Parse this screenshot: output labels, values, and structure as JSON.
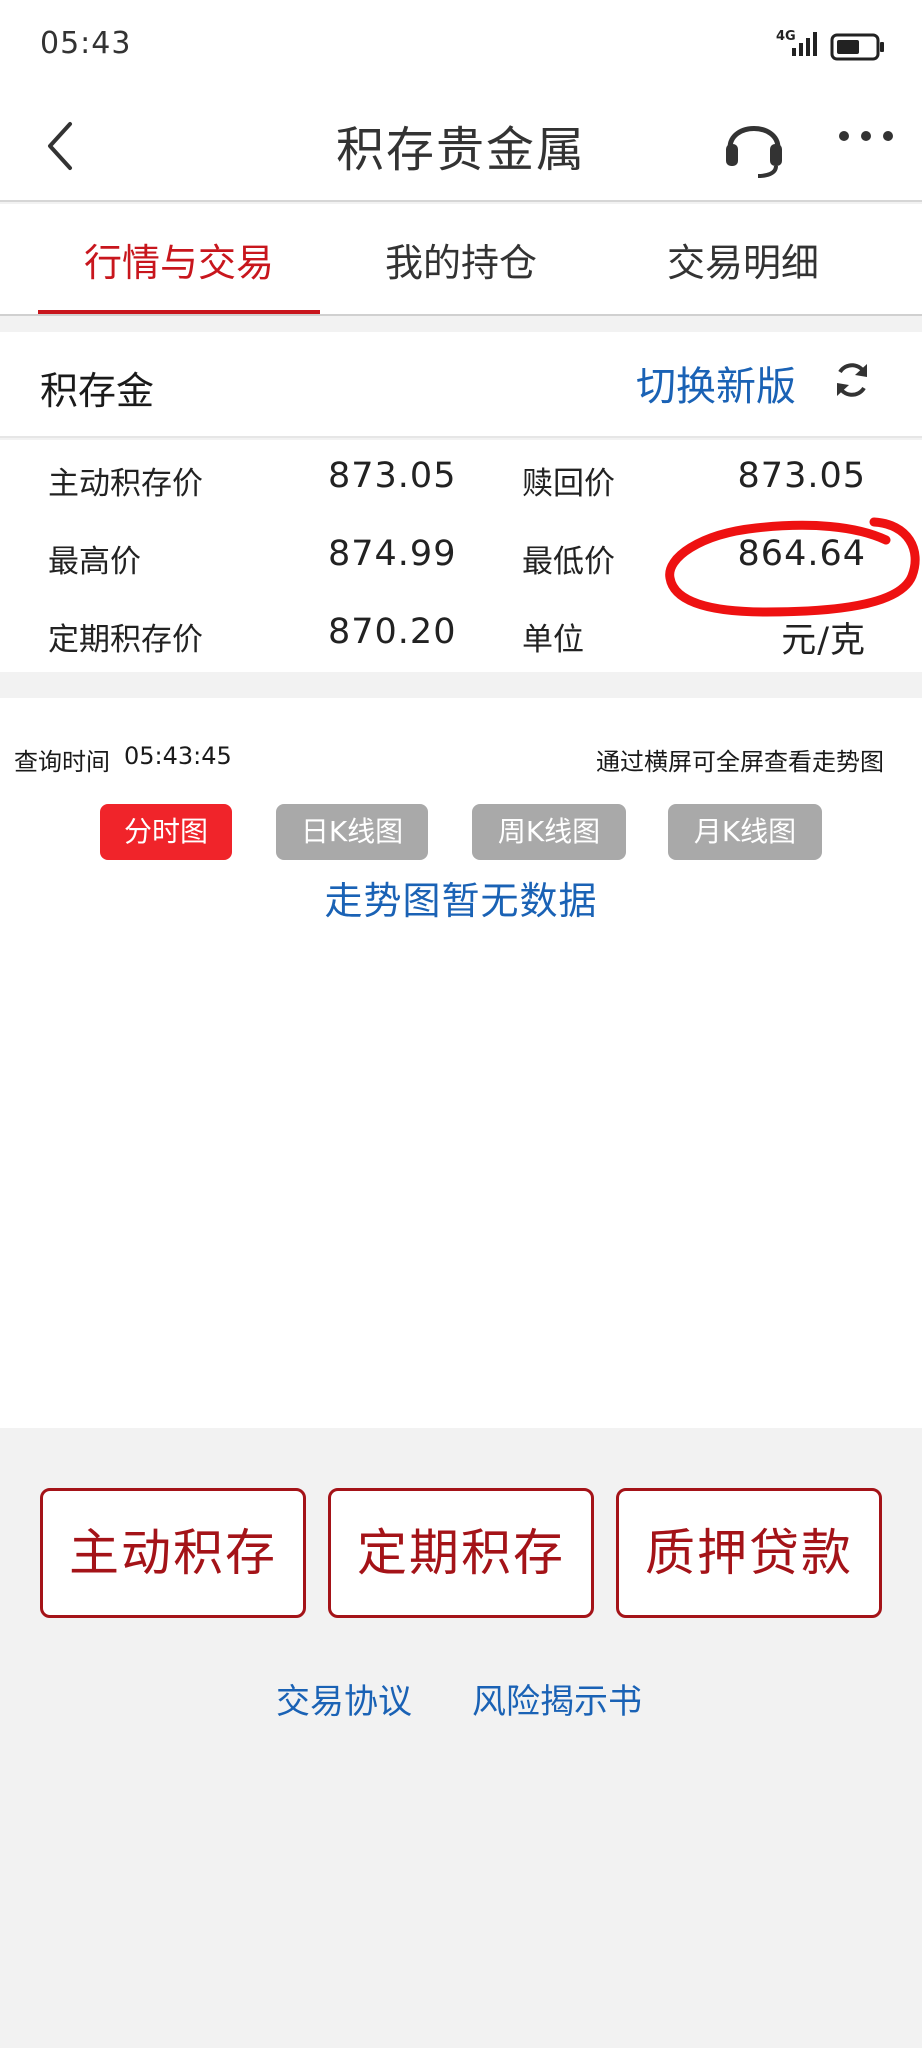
{
  "status_bar": {
    "time": "05:43",
    "network": "4G",
    "icons": [
      "signal-icon",
      "battery-icon"
    ]
  },
  "nav": {
    "title": "积存贵金属",
    "icons": [
      "back-icon",
      "headset-icon",
      "more-icon"
    ]
  },
  "tabs": [
    {
      "label": "行情与交易",
      "active": true
    },
    {
      "label": "我的持仓",
      "active": false
    },
    {
      "label": "交易明细",
      "active": false
    }
  ],
  "product": {
    "name": "积存金",
    "switch_label": "切换新版",
    "refresh_icon": "refresh-icon"
  },
  "prices": {
    "active_deposit_label": "主动积存价",
    "active_deposit_value": "873.05",
    "redeem_label": "赎回价",
    "redeem_value": "873.05",
    "high_label": "最高价",
    "high_value": "874.99",
    "low_label": "最低价",
    "low_value": "864.64",
    "fixed_deposit_label": "定期积存价",
    "fixed_deposit_value": "870.20",
    "unit_label": "单位",
    "unit_value": "元/克"
  },
  "chart": {
    "query_label": "查询时间",
    "query_time": "05:43:45",
    "landscape_tip": "通过横屏可全屏查看走势图",
    "buttons": [
      {
        "label": "分时图",
        "active": true
      },
      {
        "label": "日K线图",
        "active": false
      },
      {
        "label": "周K线图",
        "active": false
      },
      {
        "label": "月K线图",
        "active": false
      }
    ],
    "no_data": "走势图暂无数据"
  },
  "actions": [
    {
      "label": "主动积存"
    },
    {
      "label": "定期积存"
    },
    {
      "label": "质押贷款"
    }
  ],
  "links": [
    {
      "label": "交易协议"
    },
    {
      "label": "风险揭示书"
    }
  ],
  "colors": {
    "brand_red": "#c8161d",
    "active_chart_button": "#f0242a",
    "link_blue": "#1a62b5",
    "annotation_red": "#ee1111"
  }
}
